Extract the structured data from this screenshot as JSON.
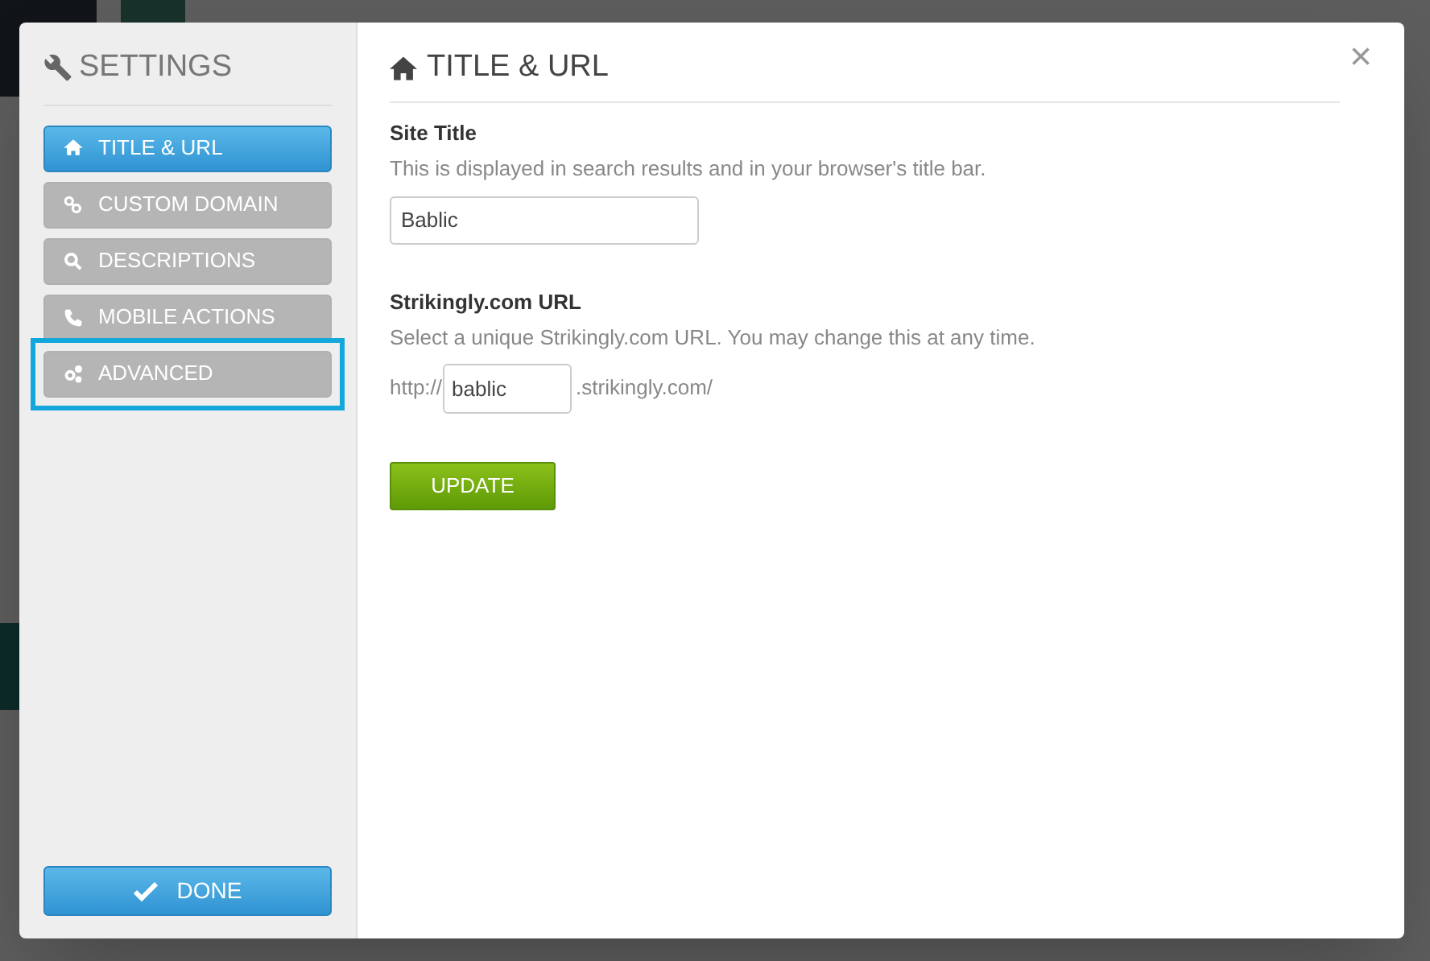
{
  "sidebar": {
    "title": "SETTINGS",
    "items": [
      {
        "label": "TITLE & URL",
        "selected": true,
        "highlighted": false
      },
      {
        "label": "CUSTOM DOMAIN",
        "selected": false,
        "highlighted": false
      },
      {
        "label": "DESCRIPTIONS",
        "selected": false,
        "highlighted": false
      },
      {
        "label": "MOBILE ACTIONS",
        "selected": false,
        "highlighted": false
      },
      {
        "label": "ADVANCED",
        "selected": false,
        "highlighted": true
      }
    ],
    "done_button": "DONE"
  },
  "panel": {
    "title": "TITLE & URL",
    "close": "×",
    "site_title": {
      "label": "Site Title",
      "help": "This is displayed in search results and in your browser's title bar.",
      "value": "Bablic"
    },
    "url": {
      "label": "Strikingly.com URL",
      "help": "Select a unique Strikingly.com URL. You may change this at any time.",
      "prefix": "http://",
      "value": "bablic",
      "suffix": ".strikingly.com/"
    },
    "update_button": "UPDATE"
  }
}
